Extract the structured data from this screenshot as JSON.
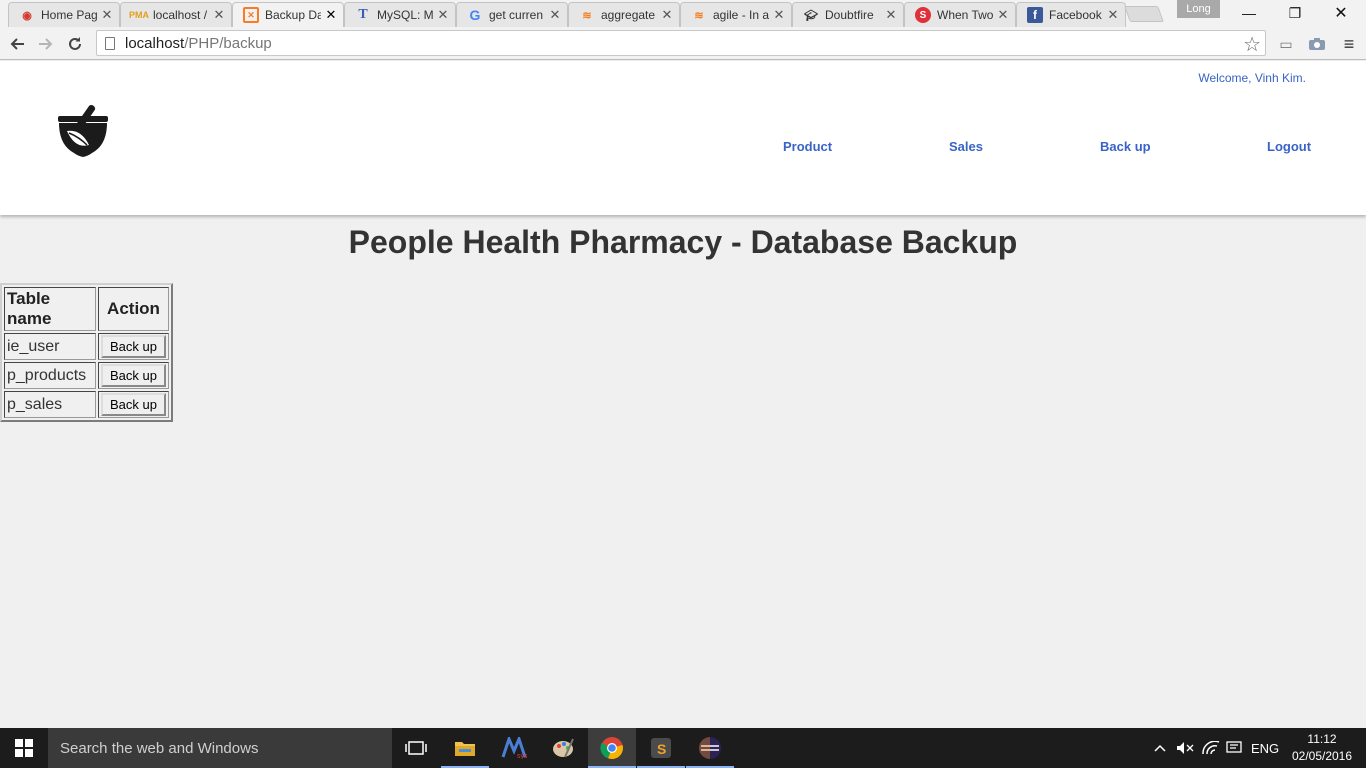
{
  "browser": {
    "tabs": [
      {
        "title": "Home Pag",
        "favicon": "joomla-icon"
      },
      {
        "title": "localhost /",
        "favicon": "phpmyadmin-icon"
      },
      {
        "title": "Backup Da",
        "favicon": "xampp-icon",
        "active": true
      },
      {
        "title": "MySQL: M",
        "favicon": "t-icon"
      },
      {
        "title": "get curren",
        "favicon": "google-icon"
      },
      {
        "title": "aggregate",
        "favicon": "stackoverflow-icon"
      },
      {
        "title": "agile - In a",
        "favicon": "stackoverflow-icon"
      },
      {
        "title": "Doubtfire",
        "favicon": "graduation-cap-icon"
      },
      {
        "title": "When Two",
        "favicon": "red-logo-icon"
      },
      {
        "title": "Facebook",
        "favicon": "facebook-icon"
      }
    ],
    "user_badge": "Long",
    "url_host": "localhost",
    "url_path": "/PHP/backup"
  },
  "site": {
    "welcome": "Welcome, Vinh Kim.",
    "nav": [
      "Product",
      "Sales",
      "Back up",
      "Logout"
    ],
    "link_color": "#3a63c7"
  },
  "page": {
    "title": "People Health Pharmacy - Database Backup",
    "table": {
      "headers": [
        "Table name",
        "Action"
      ],
      "rows": [
        {
          "name": "ie_user",
          "action": "Back up"
        },
        {
          "name": "p_products",
          "action": "Back up"
        },
        {
          "name": "p_sales",
          "action": "Back up"
        }
      ]
    }
  },
  "taskbar": {
    "search_placeholder": "Search the web and Windows",
    "language": "ENG",
    "time": "11:12",
    "date": "02/05/2016"
  }
}
